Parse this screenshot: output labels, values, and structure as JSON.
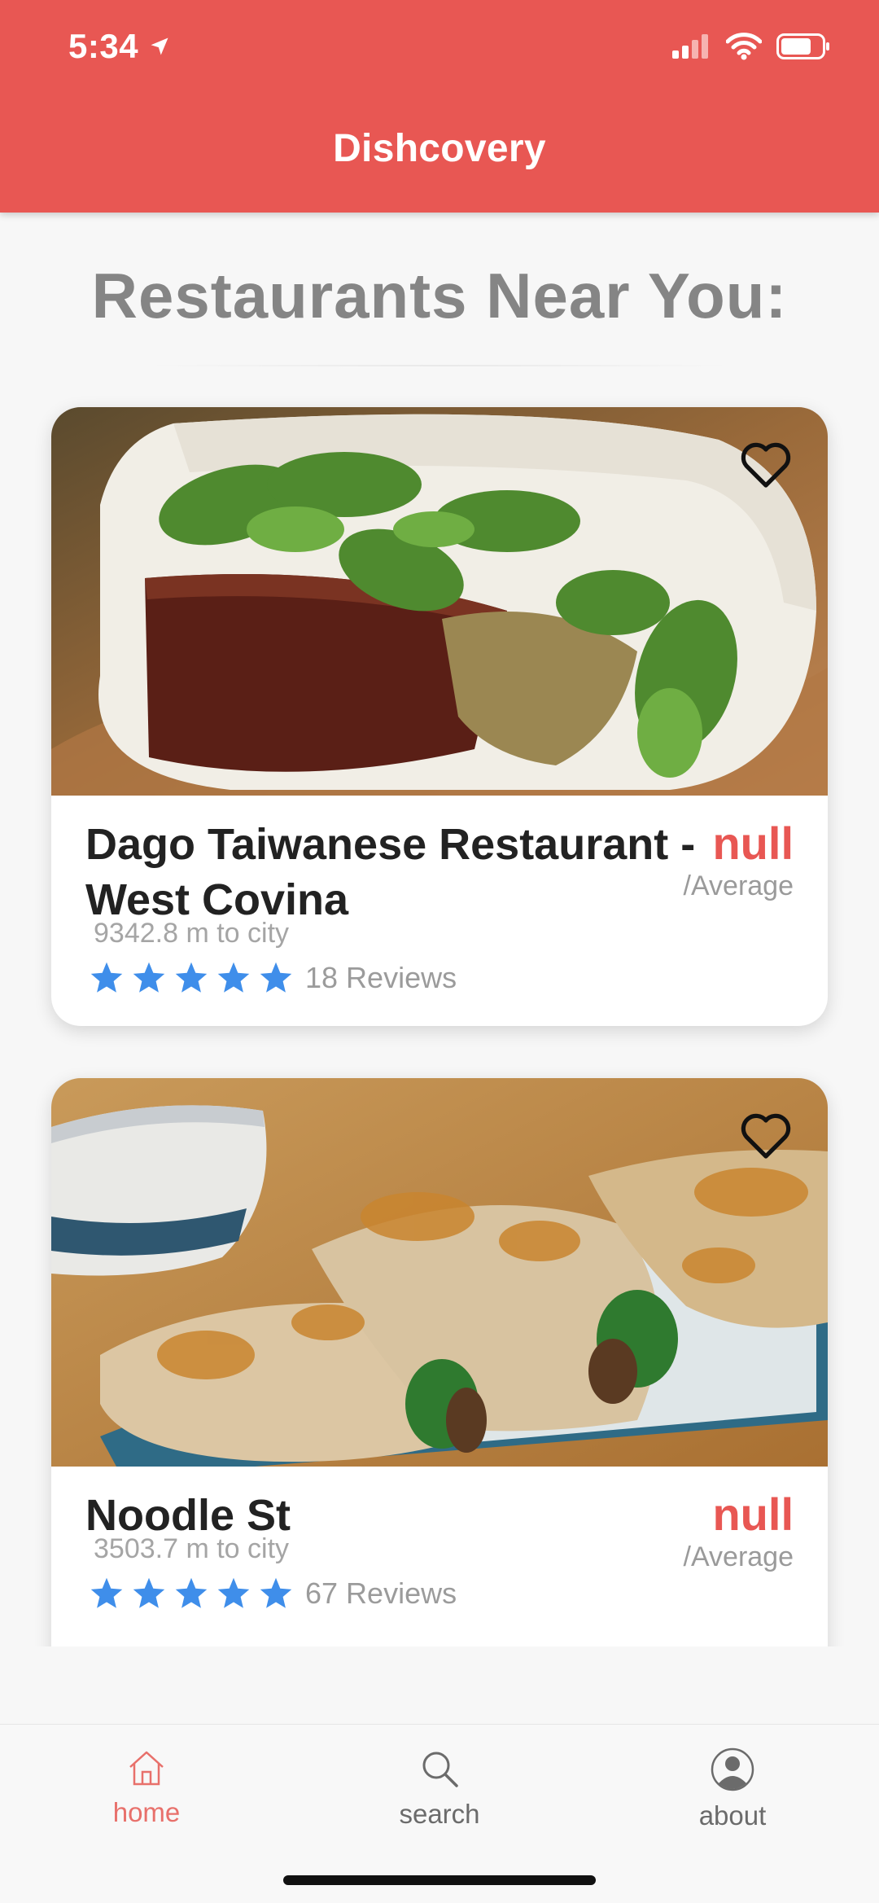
{
  "status_bar": {
    "time": "5:34"
  },
  "header": {
    "title": "Dishcovery"
  },
  "page": {
    "title": "Restaurants Near You:"
  },
  "restaurants": [
    {
      "name": "Dago Taiwanese Restaurant - West Covina",
      "price": "null",
      "price_label": "/Average",
      "distance": "9342.8 m to city",
      "rating_stars": 5,
      "reviews": "18 Reviews",
      "image_icon": "food-photo-pork-bun"
    },
    {
      "name": "Noodle St",
      "price": "null",
      "price_label": "/Average",
      "distance": "3503.7 m to city",
      "rating_stars": 5,
      "reviews": "67 Reviews",
      "image_icon": "food-photo-beef-roll"
    }
  ],
  "tabbar": {
    "items": [
      {
        "label": "home",
        "icon": "home-icon",
        "active": true
      },
      {
        "label": "search",
        "icon": "search-icon",
        "active": false
      },
      {
        "label": "about",
        "icon": "person-icon",
        "active": false
      }
    ]
  },
  "colors": {
    "brand": "#e85753",
    "star": "#3f8eea",
    "tab_active": "#e8706b"
  }
}
